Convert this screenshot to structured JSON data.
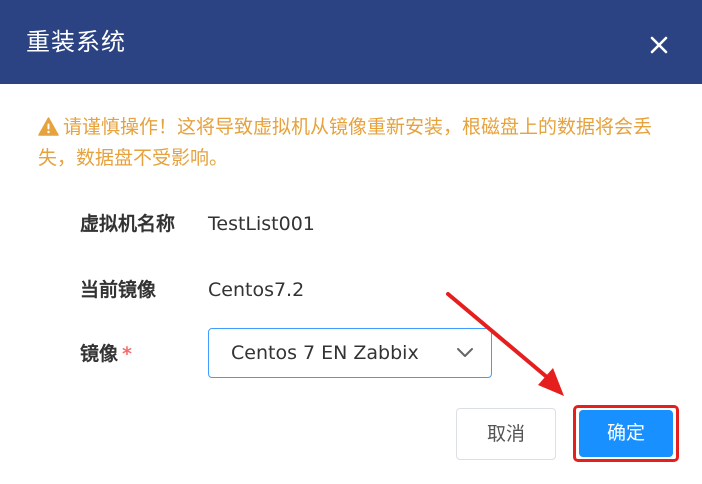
{
  "dialog": {
    "title": "重装系统"
  },
  "warning": {
    "text": "请谨慎操作！这将导致虚拟机从镜像重新安装，根磁盘上的数据将会丢失，数据盘不受影响。"
  },
  "fields": {
    "vm_name_label": "虚拟机名称",
    "vm_name_value": "TestList001",
    "current_image_label": "当前镜像",
    "current_image_value": "Centos7.2",
    "image_label": "镜像",
    "image_required_mark": "*",
    "image_selected": "Centos 7 EN Zabbix"
  },
  "buttons": {
    "cancel_label": "取消",
    "confirm_label": "确定"
  },
  "icons": {
    "close": "close-icon",
    "warning": "warning-icon",
    "chevron": "chevron-down-icon"
  },
  "colors": {
    "header_bg": "#2b4383",
    "warning": "#e6a23c",
    "primary": "#1890ff",
    "annotation": "#e51e1e",
    "required": "#f56c6c"
  }
}
